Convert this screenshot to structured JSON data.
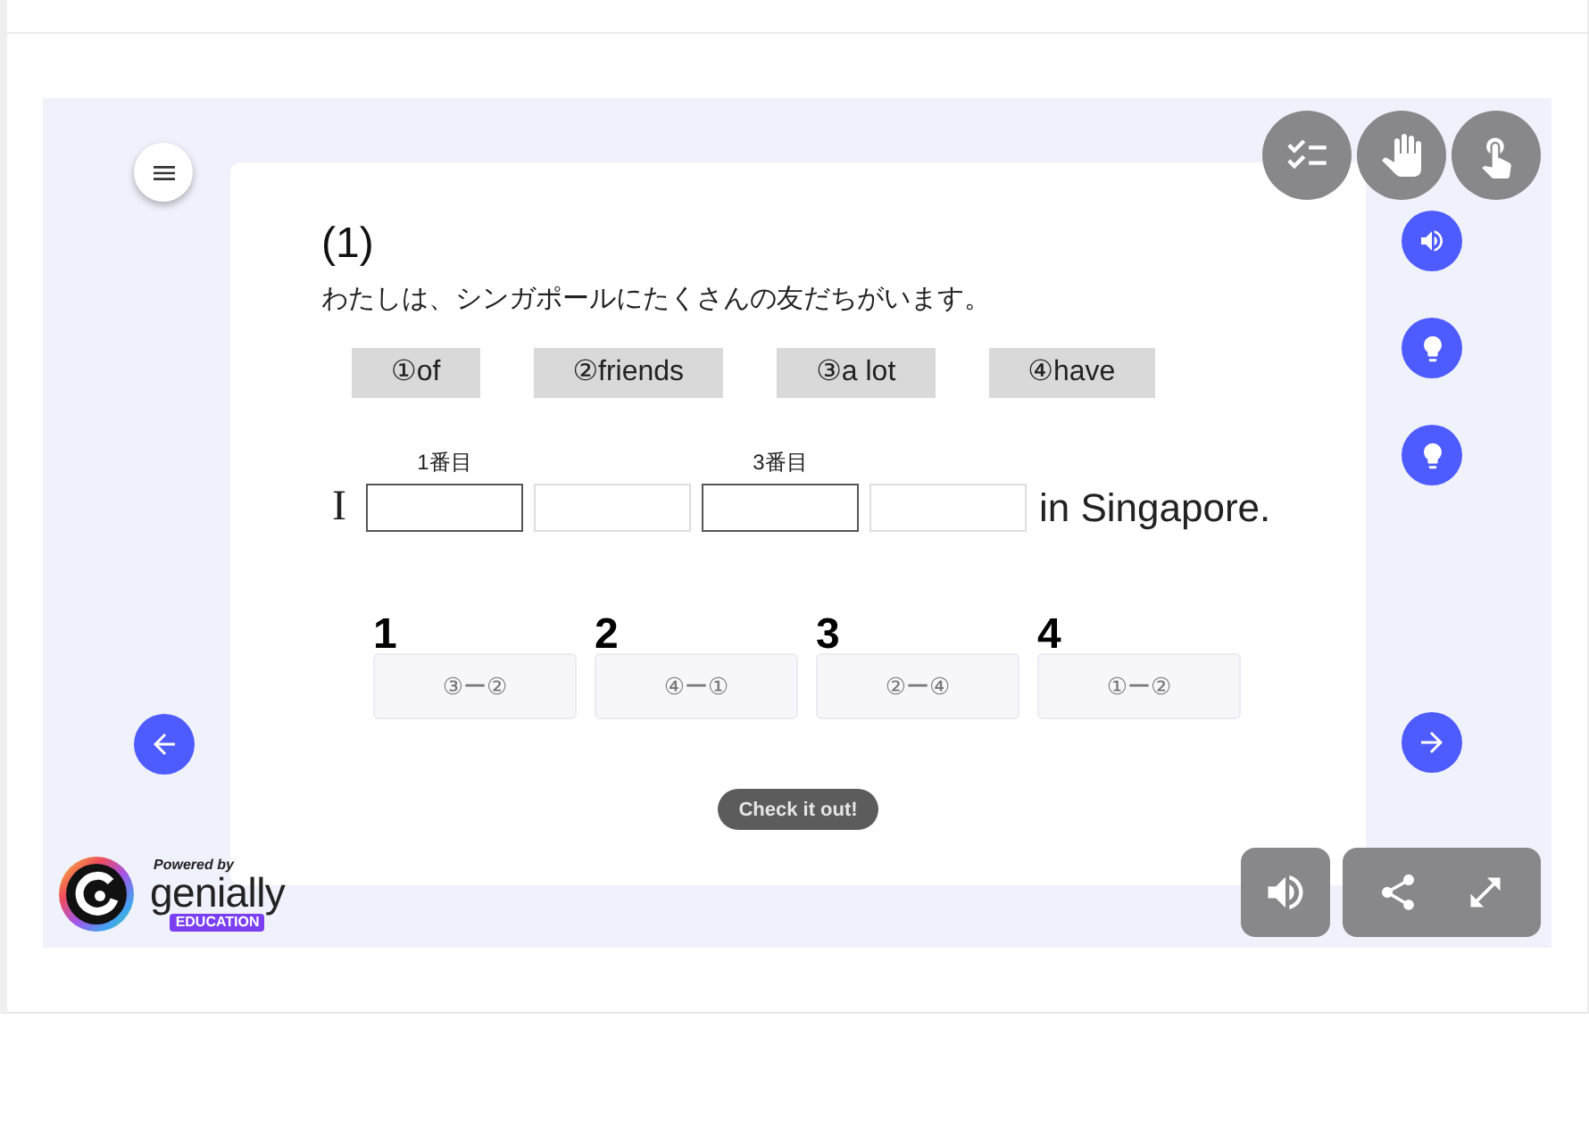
{
  "question": {
    "number": "(1)",
    "sentence": "わたしは、シンガポールにたくさんの友だちがいます。"
  },
  "word_chips": [
    "①of",
    "②friends",
    "③a lot",
    "④have"
  ],
  "answer_line": {
    "start": "I",
    "blanks": [
      {
        "label": "1番目",
        "marked": true
      },
      {
        "marked": false
      },
      {
        "label": "3番目",
        "marked": true
      },
      {
        "marked": false
      }
    ],
    "end": "in Singapore."
  },
  "choices": [
    {
      "number": "1",
      "text": "③ー②"
    },
    {
      "number": "2",
      "text": "④ー①"
    },
    {
      "number": "3",
      "text": "②ー④"
    },
    {
      "number": "4",
      "text": "①ー②"
    }
  ],
  "check_button": "Check it out!",
  "branding": {
    "powered_by": "Powered by",
    "name": "genially",
    "badge": "EDUCATION"
  }
}
